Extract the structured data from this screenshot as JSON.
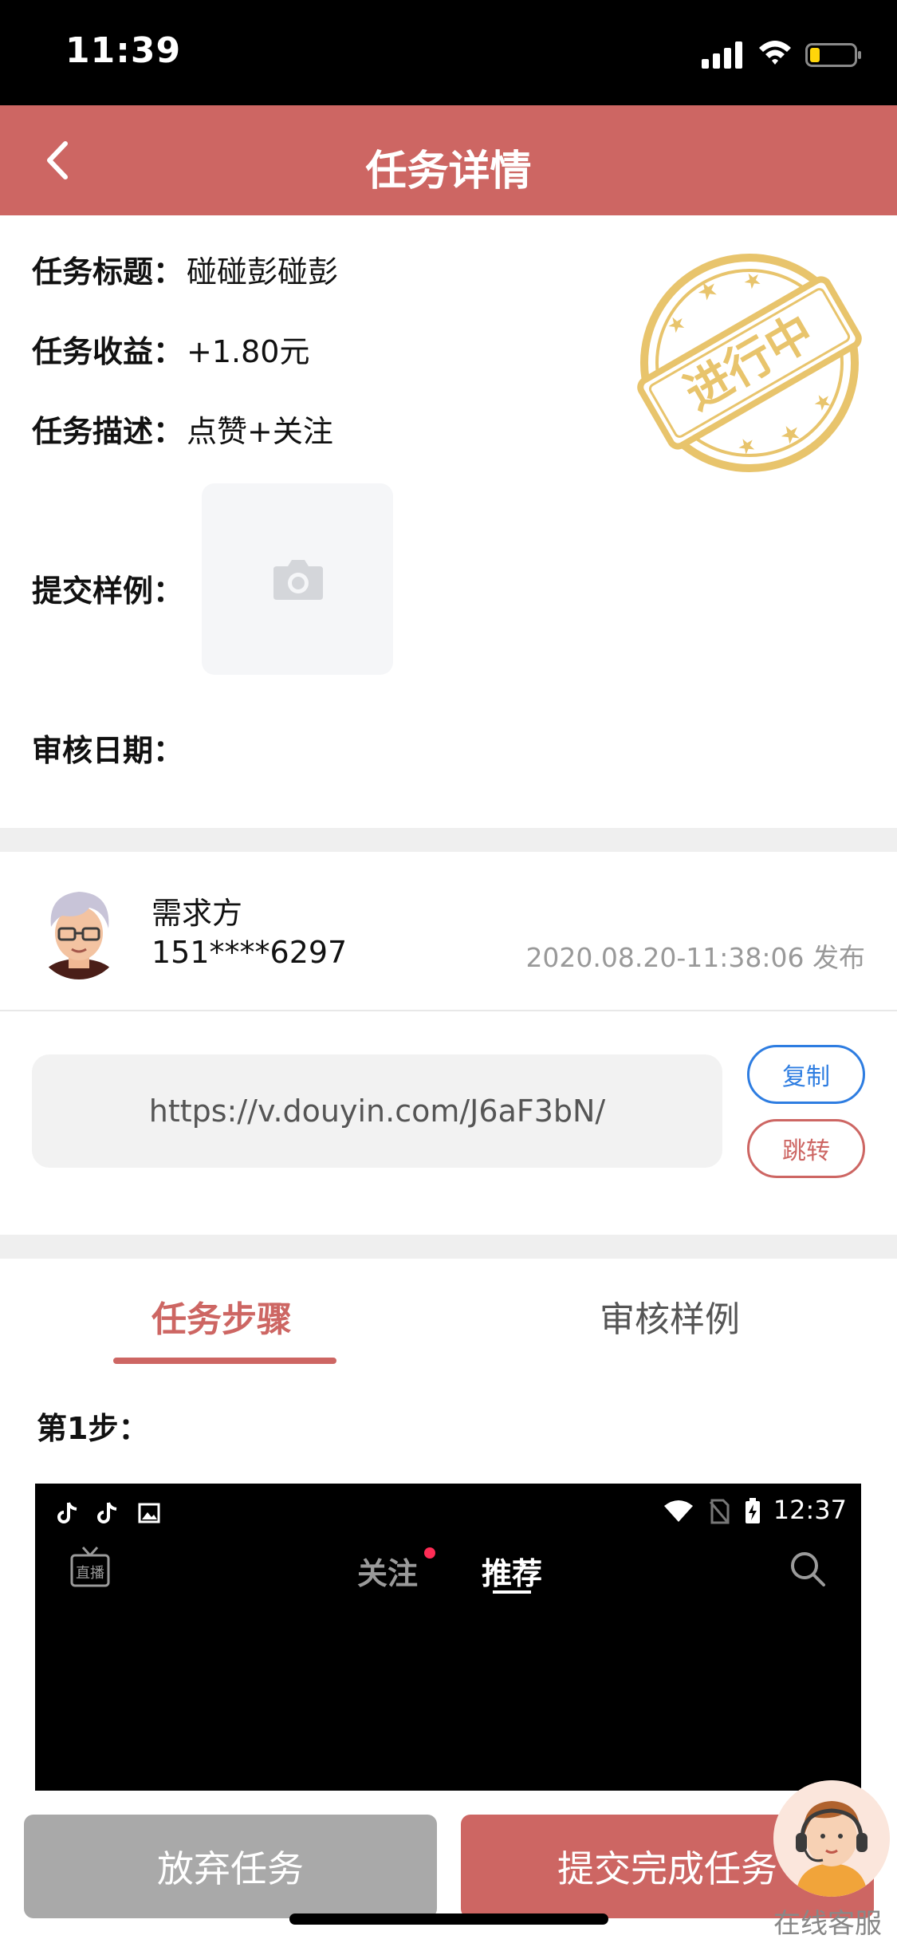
{
  "status_bar": {
    "time": "11:39"
  },
  "nav": {
    "title": "任务详情"
  },
  "task": {
    "title_label": "任务标题：",
    "title_value": "碰碰彭碰彭",
    "reward_label": "任务收益：",
    "reward_amount": "+1.80",
    "reward_unit": "元",
    "desc_label": "任务描述：",
    "desc_value": "点赞+关注",
    "sample_label": "提交样例：",
    "review_date_label": "审核日期：",
    "stamp_text": "进行中"
  },
  "publisher": {
    "role": "需求方",
    "phone": "151****6297",
    "published": "2020.08.20-11:38:06 发布"
  },
  "link": {
    "url": "https://v.douyin.com/J6aF3bN/",
    "copy_label": "复制",
    "jump_label": "跳转"
  },
  "tabs": {
    "steps": "任务步骤",
    "review": "审核样例"
  },
  "step": {
    "title": "第1步："
  },
  "screenshot": {
    "time": "12:37",
    "tab_follow": "关注",
    "tab_recommend": "推荐",
    "live_label": "直播"
  },
  "actions": {
    "abandon": "放弃任务",
    "submit": "提交完成任务"
  },
  "support": {
    "label": "在线客服"
  },
  "colors": {
    "accent": "#cd6663",
    "link_blue": "#2e7de1",
    "stamp": "#e8c46c",
    "disabled": "#a9a9a9"
  }
}
